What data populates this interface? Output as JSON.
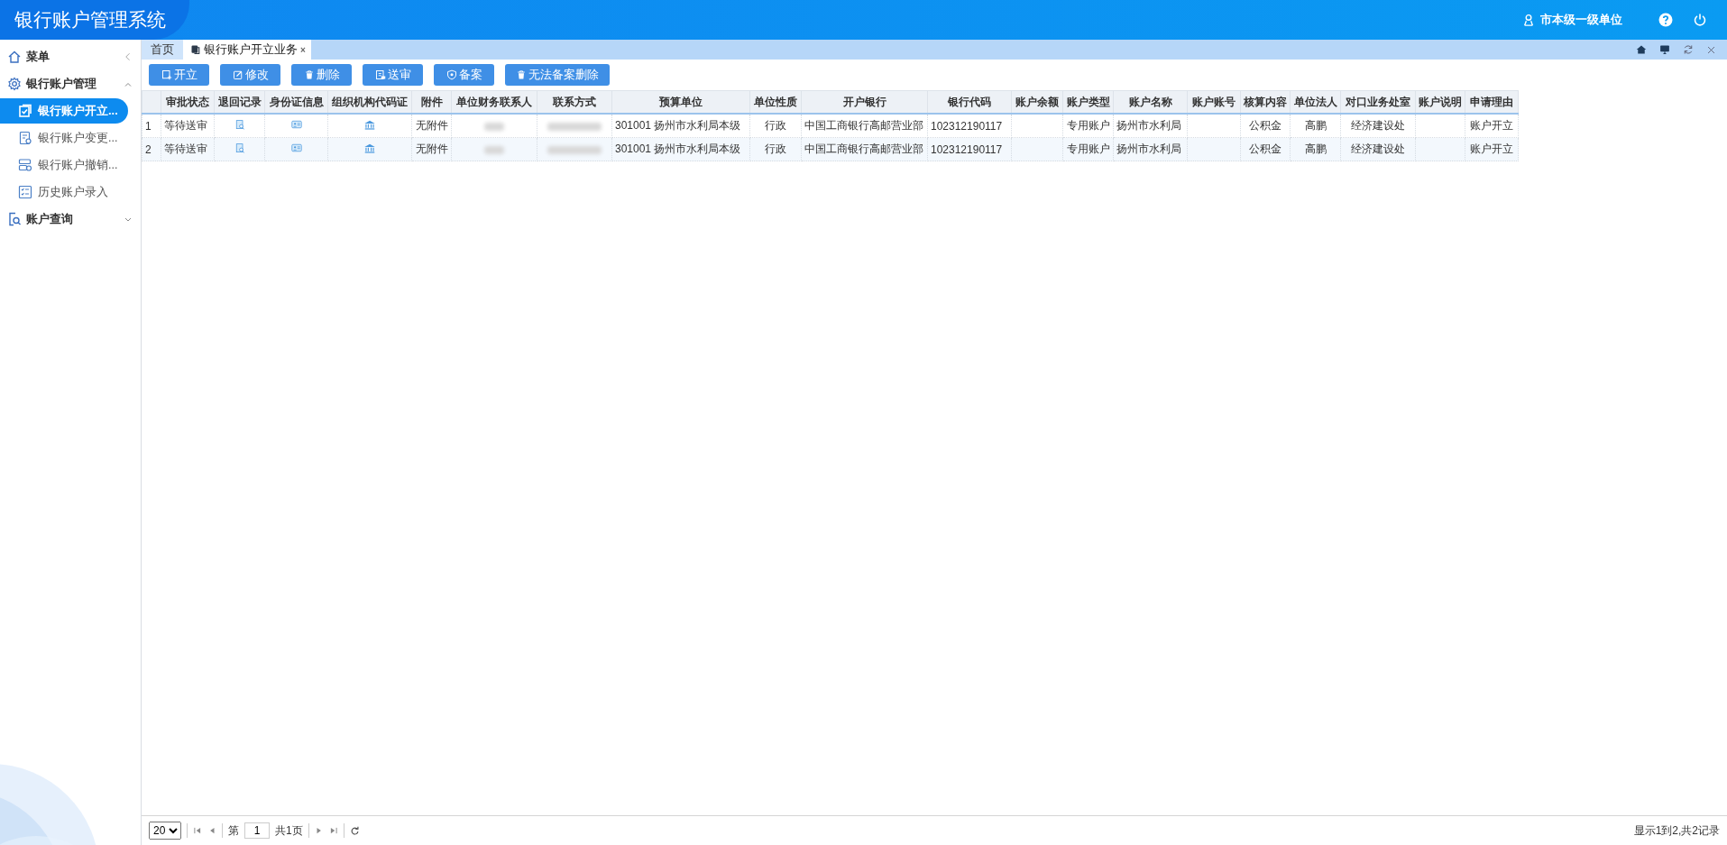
{
  "header": {
    "title": "银行账户管理系统",
    "user": "市本级一级单位"
  },
  "sidebar": {
    "title": "菜单",
    "groups": [
      {
        "label": "银行账户管理",
        "expanded": true,
        "children": [
          {
            "label": "银行账户开立...",
            "selected": true
          },
          {
            "label": "银行账户变更...",
            "selected": false
          },
          {
            "label": "银行账户撤销...",
            "selected": false
          },
          {
            "label": "历史账户录入",
            "selected": false
          }
        ]
      },
      {
        "label": "账户查询",
        "expanded": false
      }
    ]
  },
  "tabs": [
    {
      "label": "首页",
      "selected": false
    },
    {
      "label": "银行账户开立业务",
      "selected": true,
      "close": "×"
    }
  ],
  "toolbar": [
    "开立",
    "修改",
    "删除",
    "送审",
    "备案",
    "无法备案删除"
  ],
  "table": {
    "columns": [
      {
        "label": "审批状态",
        "kind": "text"
      },
      {
        "label": "退回记录",
        "kind": "record-icon"
      },
      {
        "label": "身份证信息",
        "kind": "id-card-icon"
      },
      {
        "label": "组织机构代码证",
        "kind": "bank-icon"
      },
      {
        "label": "附件",
        "kind": "text"
      },
      {
        "label": "单位财务联系人",
        "kind": "redacted"
      },
      {
        "label": "联系方式",
        "kind": "redacted"
      },
      {
        "label": "预算单位",
        "kind": "text"
      },
      {
        "label": "单位性质",
        "kind": "text"
      },
      {
        "label": "开户银行",
        "kind": "text"
      },
      {
        "label": "银行代码",
        "kind": "text"
      },
      {
        "label": "账户余额",
        "kind": "text"
      },
      {
        "label": "账户类型",
        "kind": "text"
      },
      {
        "label": "账户名称",
        "kind": "text"
      },
      {
        "label": "账户账号",
        "kind": "text"
      },
      {
        "label": "核算内容",
        "kind": "text"
      },
      {
        "label": "单位法人",
        "kind": "text"
      },
      {
        "label": "对口业务处室",
        "kind": "text"
      },
      {
        "label": "账户说明",
        "kind": "text"
      },
      {
        "label": "申请理由",
        "kind": "text"
      }
    ],
    "rows": [
      {
        "number": "1",
        "cells": [
          "等待送审",
          null,
          null,
          null,
          "无附件",
          null,
          null,
          "301001 扬州市水利局本级",
          "行政",
          "中国工商银行高邮营业部",
          "102312190117",
          null,
          "专用账户",
          "扬州市水利局",
          null,
          "公积金",
          "高鹏",
          "经济建设处",
          null,
          "账户开立"
        ]
      },
      {
        "number": "2",
        "cells": [
          "等待送审",
          null,
          null,
          null,
          "无附件",
          null,
          null,
          "301001 扬州市水利局本级",
          "行政",
          "中国工商银行高邮营业部",
          "102312190117",
          null,
          "专用账户",
          "扬州市水利局",
          null,
          "公积金",
          "高鹏",
          "经济建设处",
          null,
          "账户开立"
        ]
      }
    ]
  },
  "pager": {
    "page_size": "20",
    "page_label": "第",
    "page": "1",
    "total_pages": "共1页",
    "summary": "显示1到2,共2记录"
  }
}
